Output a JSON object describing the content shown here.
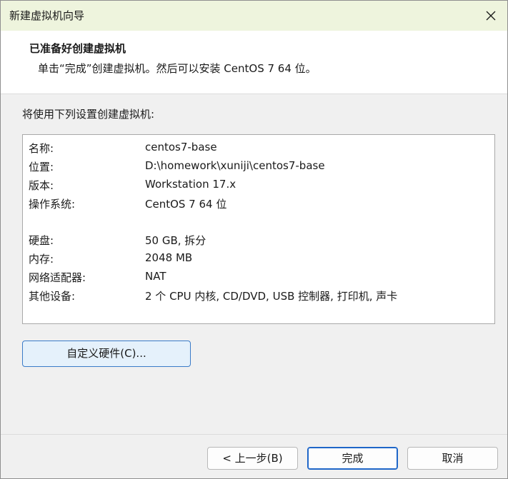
{
  "window": {
    "title": "新建虚拟机向导"
  },
  "header": {
    "title": "已准备好创建虚拟机",
    "subtitle": "单击“完成”创建虚拟机。然后可以安装 CentOS 7 64 位。"
  },
  "intro_text": "将使用下列设置创建虚拟机:",
  "summary": {
    "rows": [
      {
        "label": "名称:",
        "value": "centos7-base"
      },
      {
        "label": "位置:",
        "value": "D:\\homework\\xuniji\\centos7-base"
      },
      {
        "label": "版本:",
        "value": "Workstation 17.x"
      },
      {
        "label": "操作系统:",
        "value": "CentOS 7 64 位"
      },
      {
        "label": "硬盘:",
        "value": "50 GB, 拆分"
      },
      {
        "label": "内存:",
        "value": "2048 MB"
      },
      {
        "label": "网络适配器:",
        "value": "NAT"
      },
      {
        "label": "其他设备:",
        "value": "2 个 CPU 内核, CD/DVD, USB 控制器, 打印机, 声卡"
      }
    ]
  },
  "buttons": {
    "customize": "自定义硬件(C)...",
    "back": "< 上一步(B)",
    "finish": "完成",
    "cancel": "取消"
  },
  "icons": {
    "close": "close-icon"
  },
  "colors": {
    "titlebar_bg": "#eef4dd",
    "accent_border": "#1e66c8",
    "focused_button_bg": "#e5f1fb"
  }
}
